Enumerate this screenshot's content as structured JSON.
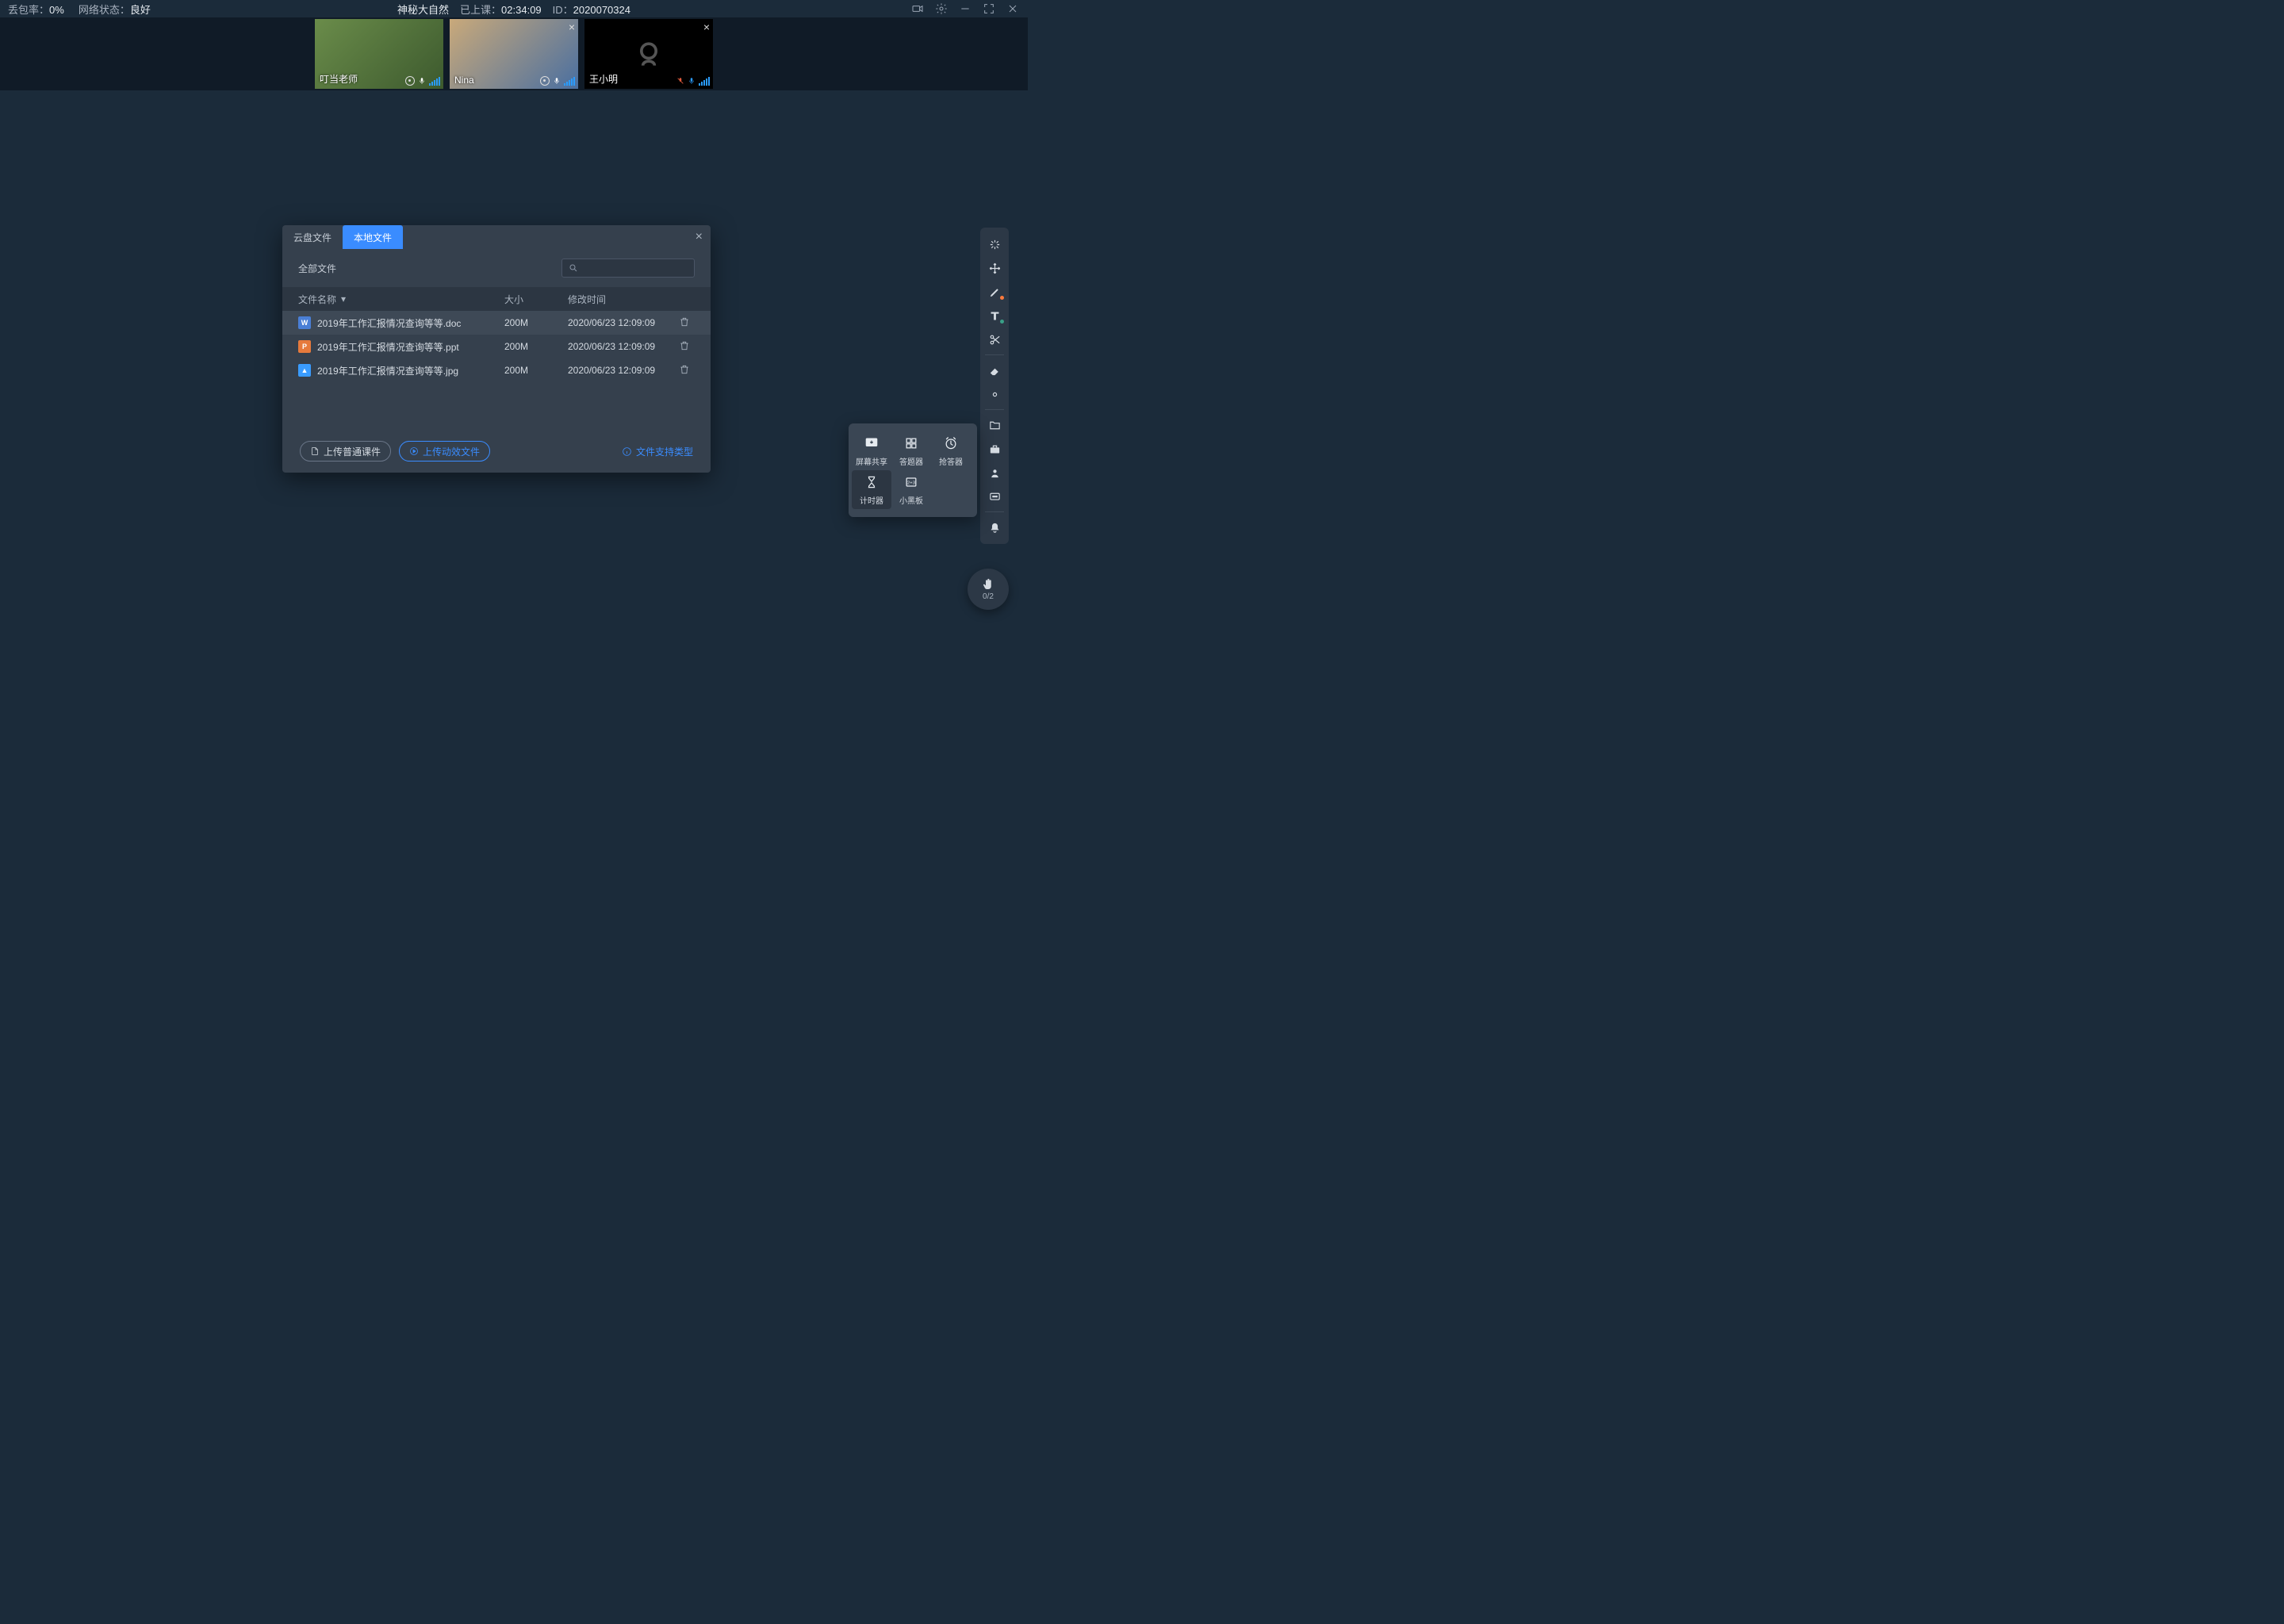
{
  "topbar": {
    "loss_label": "丢包率：",
    "loss_value": "0%",
    "net_label": "网络状态：",
    "net_value": "良好",
    "course_name": "神秘大自然",
    "duration_label": "已上课：",
    "duration_value": "02:34:09",
    "id_label": "ID：",
    "id_value": "2020070324"
  },
  "participants": [
    {
      "name": "叮当老师",
      "camera_off": false,
      "closable": false,
      "mic_muted": false
    },
    {
      "name": "Nina",
      "camera_off": false,
      "closable": true,
      "mic_muted": false
    },
    {
      "name": "王小明",
      "camera_off": true,
      "closable": true,
      "mic_muted": true
    }
  ],
  "modal": {
    "tabs": {
      "cloud": "云盘文件",
      "local": "本地文件"
    },
    "all_files": "全部文件",
    "columns": {
      "name": "文件名称",
      "size": "大小",
      "modified": "修改时间"
    },
    "rows": [
      {
        "type": "doc",
        "type_label": "W",
        "name": "2019年工作汇报情况查询等等.doc",
        "size": "200M",
        "modified": "2020/06/23 12:09:09"
      },
      {
        "type": "ppt",
        "type_label": "P",
        "name": "2019年工作汇报情况查询等等.ppt",
        "size": "200M",
        "modified": "2020/06/23 12:09:09"
      },
      {
        "type": "img",
        "type_label": "▲",
        "name": "2019年工作汇报情况查询等等.jpg",
        "size": "200M",
        "modified": "2020/06/23 12:09:09"
      }
    ],
    "upload_normal": "上传普通课件",
    "upload_dynamic": "上传动效文件",
    "support_types": "文件支持类型"
  },
  "tools_popup": {
    "screen_share": "屏幕共享",
    "answer": "答题器",
    "buzzer": "抢答器",
    "timer": "计时器",
    "whiteboard": "小黑板"
  },
  "hand_raise": {
    "count": "0/2"
  }
}
